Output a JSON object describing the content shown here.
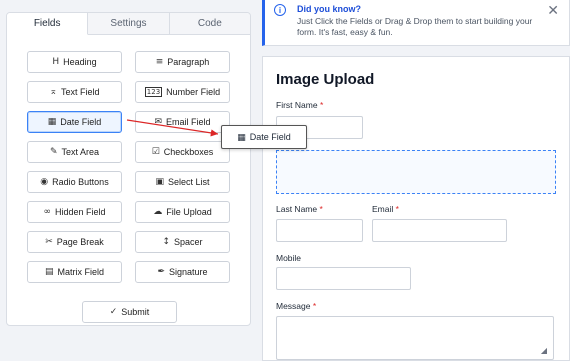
{
  "tabs": [
    {
      "label": "Fields",
      "active": true
    },
    {
      "label": "Settings",
      "active": false
    },
    {
      "label": "Code",
      "active": false
    }
  ],
  "fields": [
    {
      "label": "Heading",
      "icon": "heading-icon",
      "glyph": "H"
    },
    {
      "label": "Paragraph",
      "icon": "paragraph-icon",
      "glyph": "≡"
    },
    {
      "label": "Text Field",
      "icon": "text-field-icon",
      "glyph": "⌅"
    },
    {
      "label": "Number Field",
      "icon": "number-field-icon",
      "glyph": "123"
    },
    {
      "label": "Date Field",
      "icon": "calendar-icon",
      "glyph": "▦"
    },
    {
      "label": "Email Field",
      "icon": "envelope-icon",
      "glyph": "✉"
    },
    {
      "label": "Text Area",
      "icon": "edit-icon",
      "glyph": "✎"
    },
    {
      "label": "Checkboxes",
      "icon": "checkbox-icon",
      "glyph": "☑"
    },
    {
      "label": "Radio Buttons",
      "icon": "radio-icon",
      "glyph": "◉"
    },
    {
      "label": "Select List",
      "icon": "select-icon",
      "glyph": "▣"
    },
    {
      "label": "Hidden Field",
      "icon": "glasses-icon",
      "glyph": "∞"
    },
    {
      "label": "File Upload",
      "icon": "cloud-upload-icon",
      "glyph": "☁"
    },
    {
      "label": "Page Break",
      "icon": "scissors-icon",
      "glyph": "✂"
    },
    {
      "label": "Spacer",
      "icon": "spacer-icon",
      "glyph": "↕"
    },
    {
      "label": "Matrix Field",
      "icon": "table-icon",
      "glyph": "▤"
    },
    {
      "label": "Signature",
      "icon": "pen-icon",
      "glyph": "✒"
    },
    {
      "label": "Submit",
      "icon": "check-icon",
      "glyph": "✓"
    }
  ],
  "drag": {
    "label": "Date Field",
    "glyph": "▦"
  },
  "notice": {
    "title": "Did you know?",
    "text": "Just Click the Fields or Drag & Drop them to start building your form. It's fast, easy & fun.",
    "info_glyph": "i",
    "close_glyph": "✕"
  },
  "form": {
    "title": "Image Upload",
    "first_name_label": "First Name",
    "last_name_label": "Last Name",
    "email_label": "Email",
    "mobile_label": "Mobile",
    "message_label": "Message",
    "required_mark": "*"
  },
  "colors": {
    "accent": "#2563eb",
    "required": "#dc2626",
    "arrow": "#dc2626"
  }
}
